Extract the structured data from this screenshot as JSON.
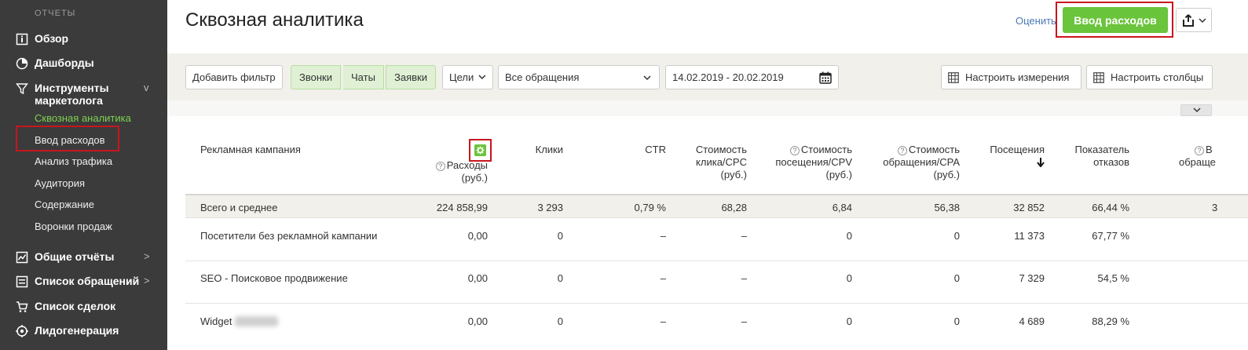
{
  "sidebar": {
    "heading": "ОТЧЕТЫ",
    "items": [
      {
        "label": "Обзор",
        "icon": "info-square-icon"
      },
      {
        "label": "Дашборды",
        "icon": "pie-chart-icon"
      },
      {
        "label": "Инструменты маркетолога",
        "icon": "funnel-icon",
        "arrow": "v"
      },
      {
        "label": "Общие отчёты",
        "icon": "chart-icon",
        "arrow": ">"
      },
      {
        "label": "Список обращений",
        "icon": "list-icon",
        "arrow": ">"
      },
      {
        "label": "Список сделок",
        "icon": "cart-icon"
      },
      {
        "label": "Лидогенерация",
        "icon": "target-icon"
      }
    ],
    "subitems": [
      "Сквозная аналитика",
      "Ввод расходов",
      "Анализ трафика",
      "Аудитория",
      "Содержание",
      "Воронки продаж"
    ]
  },
  "header": {
    "title": "Сквозная аналитика",
    "rate_link": "Оценить",
    "primary_button": "Ввод расходов"
  },
  "toolbar": {
    "add_filter": "Добавить фильтр",
    "segments": [
      "Звонки",
      "Чаты",
      "Заявки"
    ],
    "goals": "Цели",
    "requests_select": "Все обращения",
    "date_range": "14.02.2019 - 20.02.2019",
    "configure_dimensions": "Настроить измерения",
    "configure_columns": "Настроить столбцы"
  },
  "table": {
    "headers": {
      "campaign": "Рекламная кампания",
      "expenses_l1": "Расходы",
      "expenses_l2": "(руб.)",
      "clicks": "Клики",
      "ctr": "CTR",
      "cpc_l1": "Стоимость",
      "cpc_l2": "клика/CPC",
      "cpc_l3": "(руб.)",
      "cpv_l1": "Стоимость",
      "cpv_l2": "посещения/CPV",
      "cpv_l3": "(руб.)",
      "cpa_l1": "Стоимость",
      "cpa_l2": "обращения/CPA",
      "cpa_l3": "(руб.)",
      "visits": "Посещения",
      "bounce_l1": "Показатель",
      "bounce_l2": "отказов",
      "requests_l1": "В",
      "requests_l2": "обраще"
    },
    "rows": [
      {
        "campaign": "Всего и среднее",
        "expenses": "224 858,99",
        "clicks": "3 293",
        "ctr": "0,79 %",
        "cpc": "68,28",
        "cpv": "6,84",
        "cpa": "56,38",
        "visits": "32 852",
        "bounce": "66,44 %",
        "requests": "3"
      },
      {
        "campaign": "Посетители без рекламной кампании",
        "expenses": "0,00",
        "clicks": "0",
        "ctr": "–",
        "cpc": "–",
        "cpv": "0",
        "cpa": "0",
        "visits": "11 373",
        "bounce": "67,77 %",
        "requests": ""
      },
      {
        "campaign": "SEO - Поисковое продвижение",
        "expenses": "0,00",
        "clicks": "0",
        "ctr": "–",
        "cpc": "–",
        "cpv": "0",
        "cpa": "0",
        "visits": "7 329",
        "bounce": "54,5 %",
        "requests": ""
      },
      {
        "campaign": "Widget",
        "expenses": "0,00",
        "clicks": "0",
        "ctr": "–",
        "cpc": "–",
        "cpv": "0",
        "cpa": "0",
        "visits": "4 689",
        "bounce": "88,29 %",
        "requests": ""
      }
    ]
  },
  "colors": {
    "accent": "#6ac43c",
    "sidebar_bg": "#3b3b3b",
    "highlight": "#c8161d",
    "active_sub": "#7ed14e"
  }
}
